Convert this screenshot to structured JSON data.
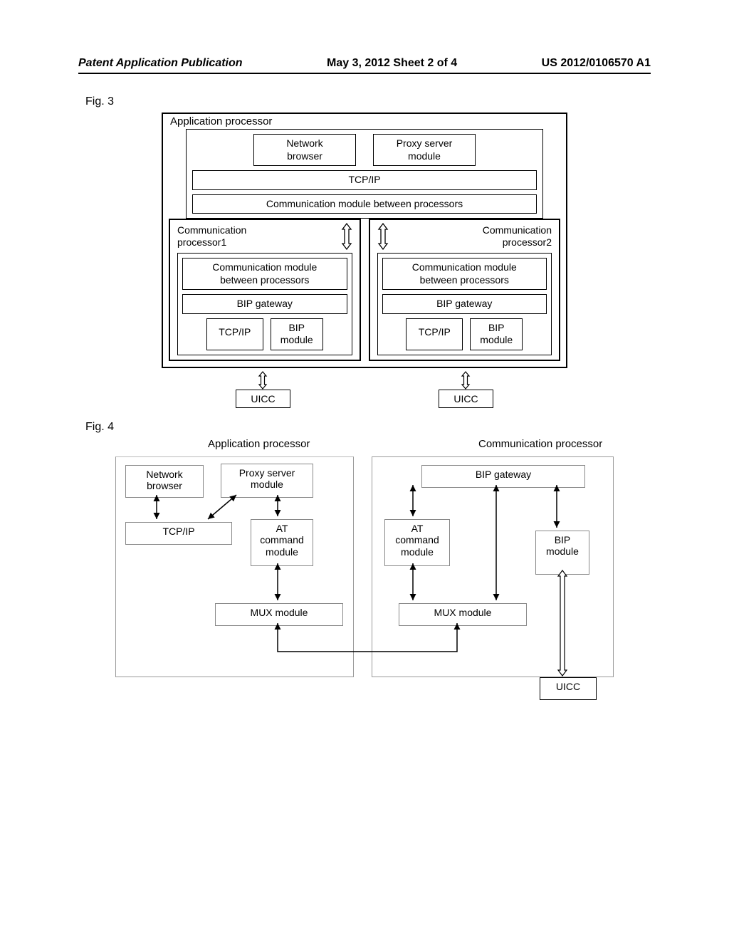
{
  "header": {
    "left": "Patent Application Publication",
    "center": "May 3, 2012  Sheet 2 of 4",
    "right": "US 2012/0106570 A1"
  },
  "fig3": {
    "label": "Fig. 3",
    "ap_title": "Application processor",
    "network_browser": "Network\nbrowser",
    "proxy_server": "Proxy server\nmodule",
    "tcpip": "TCP/IP",
    "comm_mod": "Communication module between processors",
    "cp1_title": "Communication\nprocessor1",
    "cp2_title": "Communication\nprocessor2",
    "cp_comm_mod": "Communication module\nbetween processors",
    "bip_gw": "BIP gateway",
    "cp_tcpip": "TCP/IP",
    "bip_mod": "BIP\nmodule",
    "uicc": "UICC"
  },
  "fig4": {
    "label": "Fig. 4",
    "ap_title": "Application processor",
    "cp_title": "Communication processor",
    "network_browser": "Network\nbrowser",
    "proxy_server": "Proxy server\nmodule",
    "tcpip": "TCP/IP",
    "at_cmd": "AT\ncommand\nmodule",
    "mux": "MUX module",
    "bip_gw": "BIP gateway",
    "bip_mod": "BIP\nmodule",
    "uicc": "UICC"
  },
  "chart_data": [
    {
      "type": "diagram",
      "figure": "Fig. 3",
      "title": "Multi-processor BIP architecture",
      "nodes": [
        {
          "id": "AP",
          "label": "Application processor",
          "contains": [
            "NB",
            "PS",
            "TCPIP_AP",
            "COMM_AP"
          ]
        },
        {
          "id": "NB",
          "label": "Network browser"
        },
        {
          "id": "PS",
          "label": "Proxy server module"
        },
        {
          "id": "TCPIP_AP",
          "label": "TCP/IP"
        },
        {
          "id": "COMM_AP",
          "label": "Communication module between processors"
        },
        {
          "id": "CP1",
          "label": "Communication processor1",
          "contains": [
            "COMM_CP1",
            "BIPGW1",
            "TCPIP1",
            "BIPM1"
          ]
        },
        {
          "id": "CP2",
          "label": "Communication processor2",
          "contains": [
            "COMM_CP2",
            "BIPGW2",
            "TCPIP2",
            "BIPM2"
          ]
        },
        {
          "id": "COMM_CP1",
          "label": "Communication module between processors"
        },
        {
          "id": "COMM_CP2",
          "label": "Communication module between processors"
        },
        {
          "id": "BIPGW1",
          "label": "BIP gateway"
        },
        {
          "id": "BIPGW2",
          "label": "BIP gateway"
        },
        {
          "id": "TCPIP1",
          "label": "TCP/IP"
        },
        {
          "id": "TCPIP2",
          "label": "TCP/IP"
        },
        {
          "id": "BIPM1",
          "label": "BIP module"
        },
        {
          "id": "BIPM2",
          "label": "BIP module"
        },
        {
          "id": "UICC1",
          "label": "UICC"
        },
        {
          "id": "UICC2",
          "label": "UICC"
        }
      ],
      "edges": [
        {
          "from": "COMM_AP",
          "to": "CP1",
          "dir": "bi"
        },
        {
          "from": "COMM_AP",
          "to": "CP2",
          "dir": "bi"
        },
        {
          "from": "CP1",
          "to": "UICC1",
          "dir": "bi"
        },
        {
          "from": "CP2",
          "to": "UICC2",
          "dir": "bi"
        }
      ]
    },
    {
      "type": "diagram",
      "figure": "Fig. 4",
      "title": "AP / CP module interaction",
      "nodes": [
        {
          "id": "AP",
          "label": "Application processor",
          "contains": [
            "NB",
            "PS",
            "TCPIP",
            "AT1",
            "MUX1"
          ]
        },
        {
          "id": "CP",
          "label": "Communication processor",
          "contains": [
            "BIPGW",
            "AT2",
            "BIPM",
            "MUX2"
          ]
        },
        {
          "id": "NB",
          "label": "Network browser"
        },
        {
          "id": "PS",
          "label": "Proxy server module"
        },
        {
          "id": "TCPIP",
          "label": "TCP/IP"
        },
        {
          "id": "AT1",
          "label": "AT command module"
        },
        {
          "id": "MUX1",
          "label": "MUX module"
        },
        {
          "id": "BIPGW",
          "label": "BIP gateway"
        },
        {
          "id": "AT2",
          "label": "AT command module"
        },
        {
          "id": "BIPM",
          "label": "BIP module"
        },
        {
          "id": "MUX2",
          "label": "MUX module"
        },
        {
          "id": "UICC",
          "label": "UICC"
        }
      ],
      "edges": [
        {
          "from": "NB",
          "to": "TCPIP",
          "dir": "bi"
        },
        {
          "from": "PS",
          "to": "TCPIP",
          "dir": "bi"
        },
        {
          "from": "PS",
          "to": "AT1",
          "dir": "bi"
        },
        {
          "from": "AT1",
          "to": "MUX1",
          "dir": "bi"
        },
        {
          "from": "MUX1",
          "to": "MUX2",
          "dir": "bi"
        },
        {
          "from": "MUX2",
          "to": "AT2",
          "dir": "bi"
        },
        {
          "from": "AT2",
          "to": "BIPGW",
          "dir": "bi"
        },
        {
          "from": "BIPGW",
          "to": "BIPM",
          "dir": "bi"
        },
        {
          "from": "BIPGW",
          "to": "MUX2",
          "dir": "bi"
        },
        {
          "from": "BIPM",
          "to": "UICC",
          "dir": "bi"
        }
      ]
    }
  ]
}
